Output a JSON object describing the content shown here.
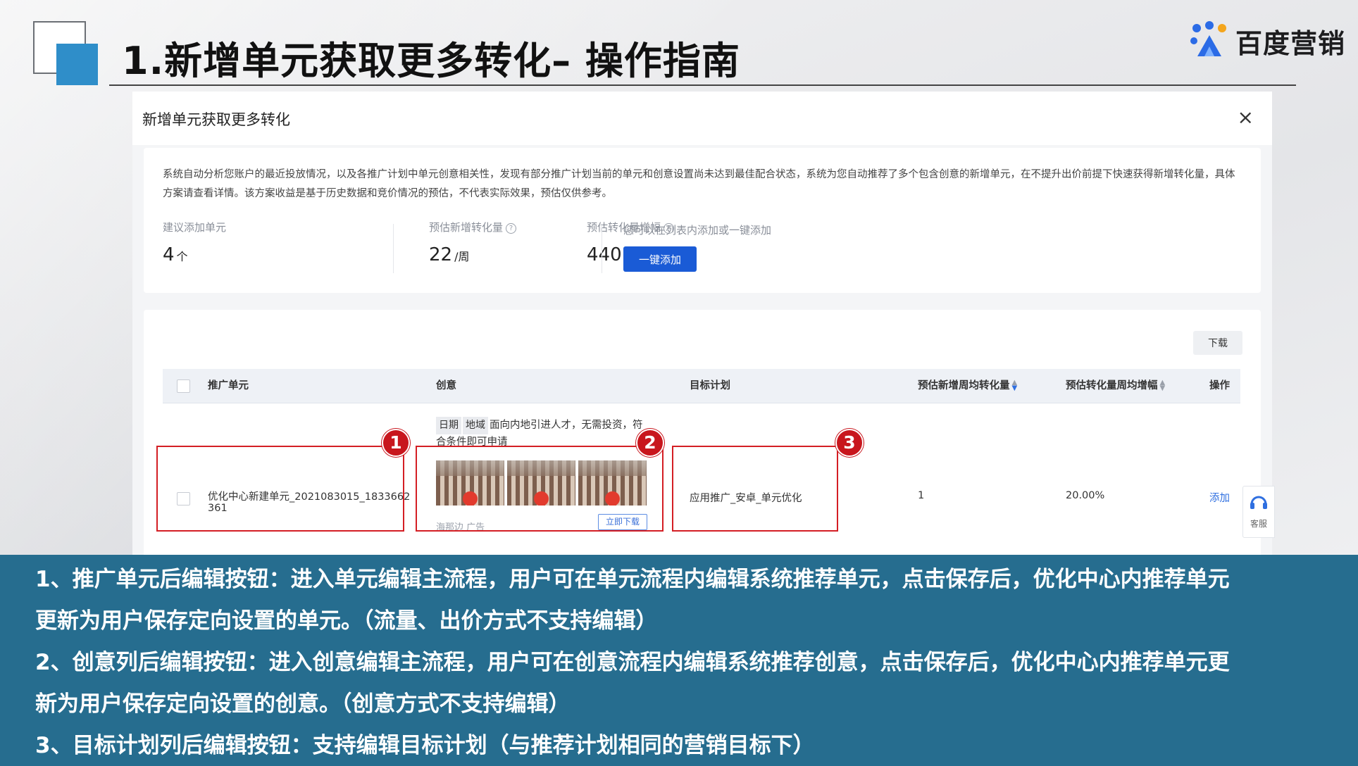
{
  "slide": {
    "title": "1.新增单元获取更多转化– 操作指南",
    "logo_text": "百度营销"
  },
  "dialog": {
    "title": "新增单元获取更多转化",
    "close": "×",
    "description": "系统自动分析您账户的最近投放情况，以及各推广计划中单元创意相关性，发现有部分推广计划当前的单元和创意设置尚未达到最佳配合状态，系统为您自动推荐了多个包含创意的新增单元，在不提升出价前提下快速获得新增转化量，具体方案请查看详情。该方案收益是基于历史数据和竞价情况的预估，不代表实际效果，预估仅供参考。",
    "metrics": [
      {
        "label": "建议添加单元",
        "value": "4",
        "unit": "个"
      },
      {
        "label": "预估新增转化量",
        "value": "22",
        "unit": "/周"
      },
      {
        "label": "预估转化量增幅",
        "value": "440.00%",
        "unit": "/周"
      }
    ],
    "add_hint": "您可以在列表内添加或一键添加",
    "add_all_label": "一键添加",
    "download_label": "下载",
    "columns": {
      "unit": "推广单元",
      "creative": "创意",
      "plan": "目标计划",
      "conv": "预估新增周均转化量",
      "growth": "预估转化量周均增幅",
      "op": "操作"
    },
    "row": {
      "unit_name": "优化中心新建单元_2021083015_1833662361",
      "creative_tags": [
        "日期",
        "地域"
      ],
      "creative_text": "面向内地引进人才，无需投资，符合条件即可申请",
      "download_btn": "立即下载",
      "ad_tag": "海那边 广告",
      "plan": "应用推广_安卓_单元优化",
      "conv": "1",
      "growth": "20.00%",
      "op": "添加"
    },
    "service_label": "客服"
  },
  "badges": [
    "1",
    "2",
    "3"
  ],
  "notes": [
    "1、推广单元后编辑按钮：进入单元编辑主流程，用户可在单元流程内编辑系统推荐单元，点击保存后，优化中心内推荐单元",
    "更新为用户保存定向设置的单元。（流量、出价方式不支持编辑）",
    "2、创意列后编辑按钮：进入创意编辑主流程，用户可在创意流程内编辑系统推荐创意，点击保存后，优化中心内推荐单元更",
    "新为用户保存定向设置的创意。（创意方式不支持编辑）",
    "3、目标计划列后编辑按钮：支持编辑目标计划（与推荐计划相同的营销目标下）"
  ],
  "colors": {
    "accent_blue": "#1a5bd6",
    "note_bg": "#266d8f",
    "annotation_red": "#d41e24",
    "deco_blue": "#2f8ec9"
  }
}
